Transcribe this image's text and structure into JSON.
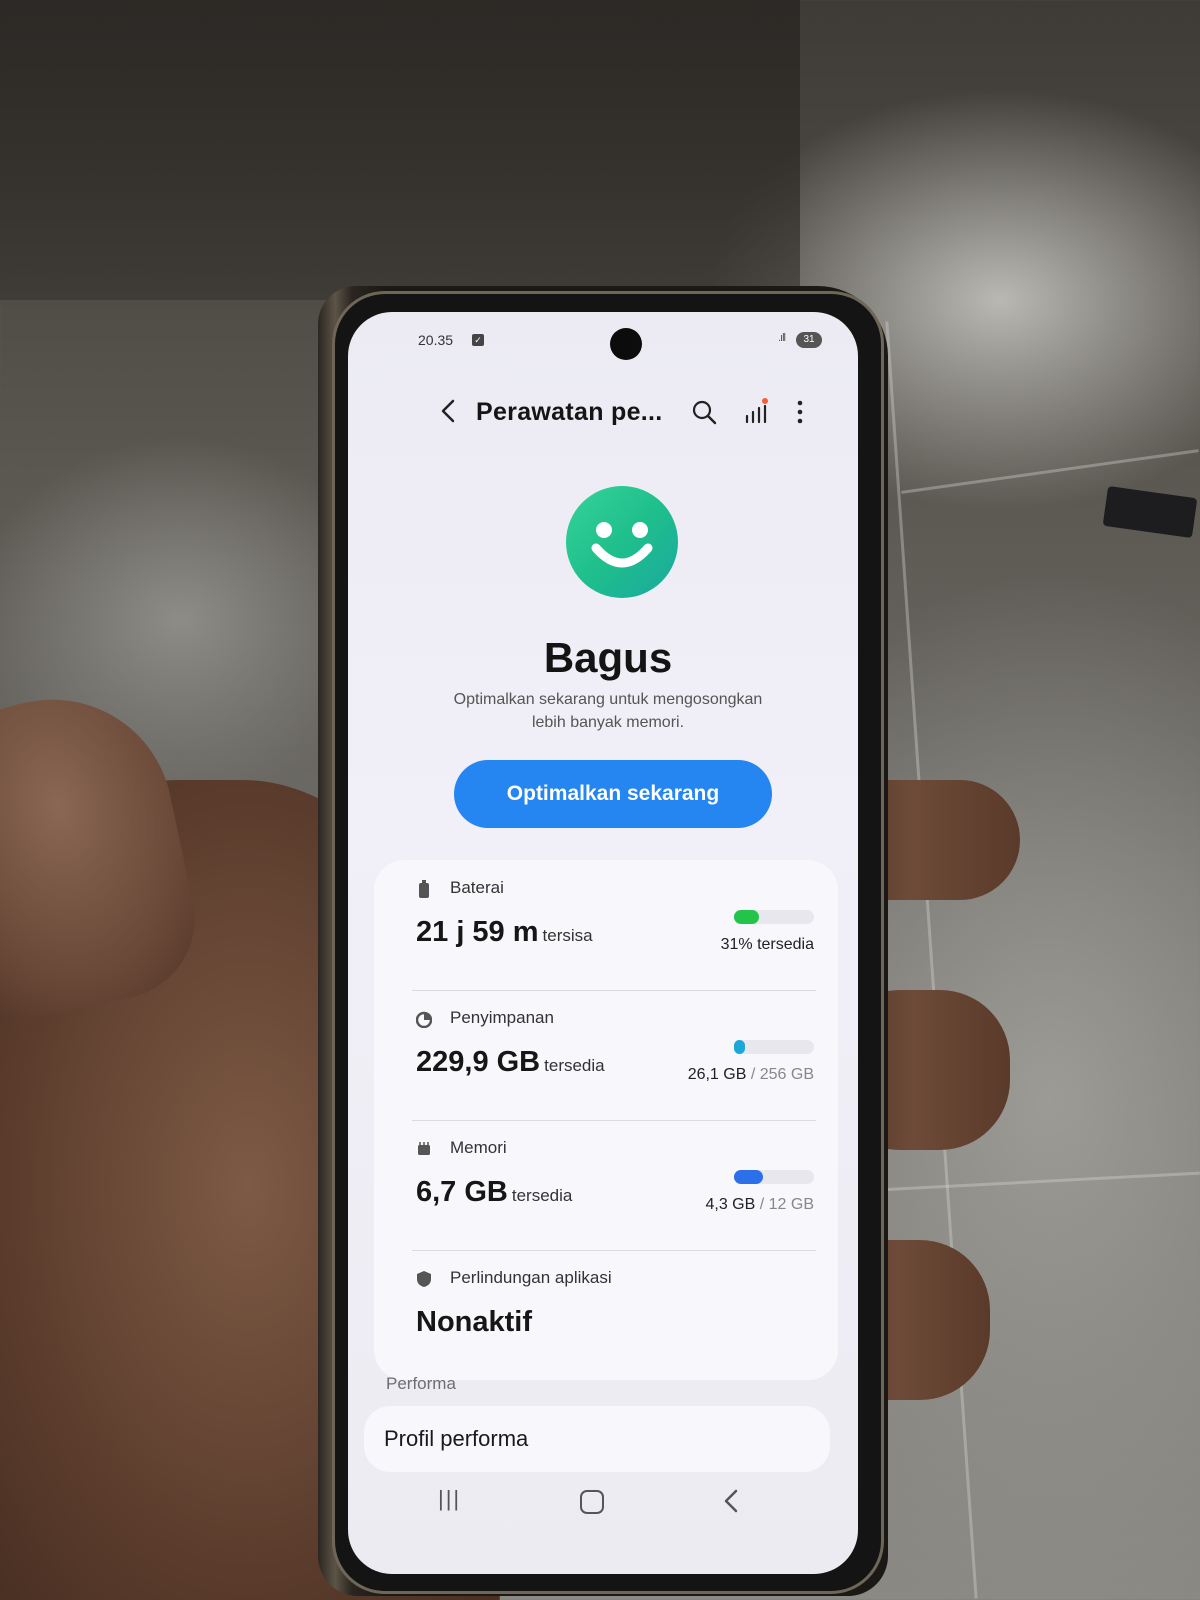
{
  "status_bar": {
    "time": "20.35",
    "signal": ".ıll",
    "battery": "31"
  },
  "header": {
    "title": "Perawatan pe...",
    "icons": [
      "back-icon",
      "search-icon",
      "stats-icon",
      "more-icon"
    ]
  },
  "hero": {
    "status": "Bagus",
    "description": "Optimalkan sekarang untuk mengosongkan lebih banyak memori.",
    "button_label": "Optimalkan sekarang"
  },
  "items": {
    "battery": {
      "label": "Baterai",
      "value": "21 j 59 m",
      "suffix": "tersisa",
      "detail": "31% tersedia",
      "level": 0.31,
      "color": "#22c44a"
    },
    "storage": {
      "label": "Penyimpanan",
      "value": "229,9 GB",
      "suffix": "tersedia",
      "used": "26,1 GB",
      "total": "/ 256 GB",
      "level": 0.1,
      "color": "#1ca7d6"
    },
    "memory": {
      "label": "Memori",
      "value": "6,7 GB",
      "suffix": "tersedia",
      "used": "4,3 GB",
      "total": "/ 12 GB",
      "level": 0.36,
      "color": "#2b6fe9"
    },
    "protection": {
      "label": "Perlindungan aplikasi",
      "value": "Nonaktif"
    }
  },
  "performance": {
    "section_title": "Performa",
    "row_label": "Profil performa"
  },
  "colors": {
    "accent": "#2585f1",
    "smiley_green": "#2ac994"
  }
}
